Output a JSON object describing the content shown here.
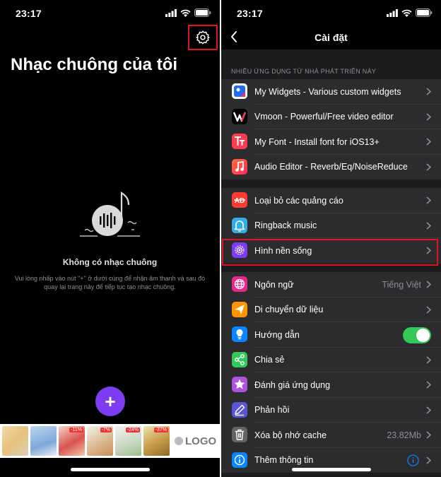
{
  "left_screen": {
    "time": "23:17",
    "title": "Nhạc chuông của tôi",
    "empty_title": "Không có nhạc chuông",
    "empty_desc": "Vui lòng nhấp vào nút \"+\" ở dưới cùng để nhận âm thanh và sau đó quay lại trang này để tiếp tục tạo nhạc chuông.",
    "fab_label": "+",
    "ad": {
      "badges": [
        "-11%",
        "-7%",
        "-24%",
        "-37%"
      ],
      "logo": "LOGO"
    }
  },
  "right_screen": {
    "time": "23:17",
    "nav_title": "Cài đặt",
    "section_header": "NHIỀU ỨNG DỤNG TỪ NHÀ PHÁT TRIỂN NÀY",
    "group1": [
      {
        "label": "My Widgets - Various custom widgets",
        "icon": "widgets-icon",
        "color": "#1e6cf0"
      },
      {
        "label": "Vmoon - Powerful/Free video editor",
        "icon": "vmoon-icon",
        "color": "#000000"
      },
      {
        "label": "My Font - Install font for iOS13+",
        "icon": "font-icon",
        "color": "#ff3b4e"
      },
      {
        "label": "Audio Editor - Reverb/Eq/NoiseReduce",
        "icon": "audio-editor-icon",
        "color": "#ff3b4e"
      }
    ],
    "group2": [
      {
        "label": "Loại bỏ các quảng cáo",
        "icon": "remove-ads-icon",
        "color": "#ff3b30"
      },
      {
        "label": "Ringback music",
        "icon": "bell-icon",
        "color": "#32ade6"
      },
      {
        "label": "Hình nền sống",
        "icon": "live-wallpaper-icon",
        "color": "#7d3cf0"
      }
    ],
    "group3": {
      "language": {
        "label": "Ngôn ngữ",
        "value": "Tiếng Việt",
        "icon": "globe-icon",
        "color": "#e6278c"
      },
      "migrate": {
        "label": "Di chuyển dữ liệu",
        "icon": "send-icon",
        "color": "#ff9500"
      },
      "guide": {
        "label": "Hướng dẫn",
        "icon": "lightbulb-icon",
        "color": "#0a84ff",
        "toggle_on": true
      },
      "share": {
        "label": "Chia sẻ",
        "icon": "share-icon",
        "color": "#34c759"
      },
      "rate": {
        "label": "Đánh giá ứng dụng",
        "icon": "star-icon",
        "color": "#af52de"
      },
      "feedback": {
        "label": "Phản hồi",
        "icon": "pencil-icon",
        "color": "#5856d6"
      },
      "clear_cache": {
        "label": "Xóa bộ nhớ cache",
        "value": "23.82Mb",
        "icon": "trash-icon",
        "color": "#636366"
      },
      "more_info": {
        "label": "Thêm thông tin",
        "icon": "info-icon",
        "color": "#0a84ff"
      }
    }
  }
}
